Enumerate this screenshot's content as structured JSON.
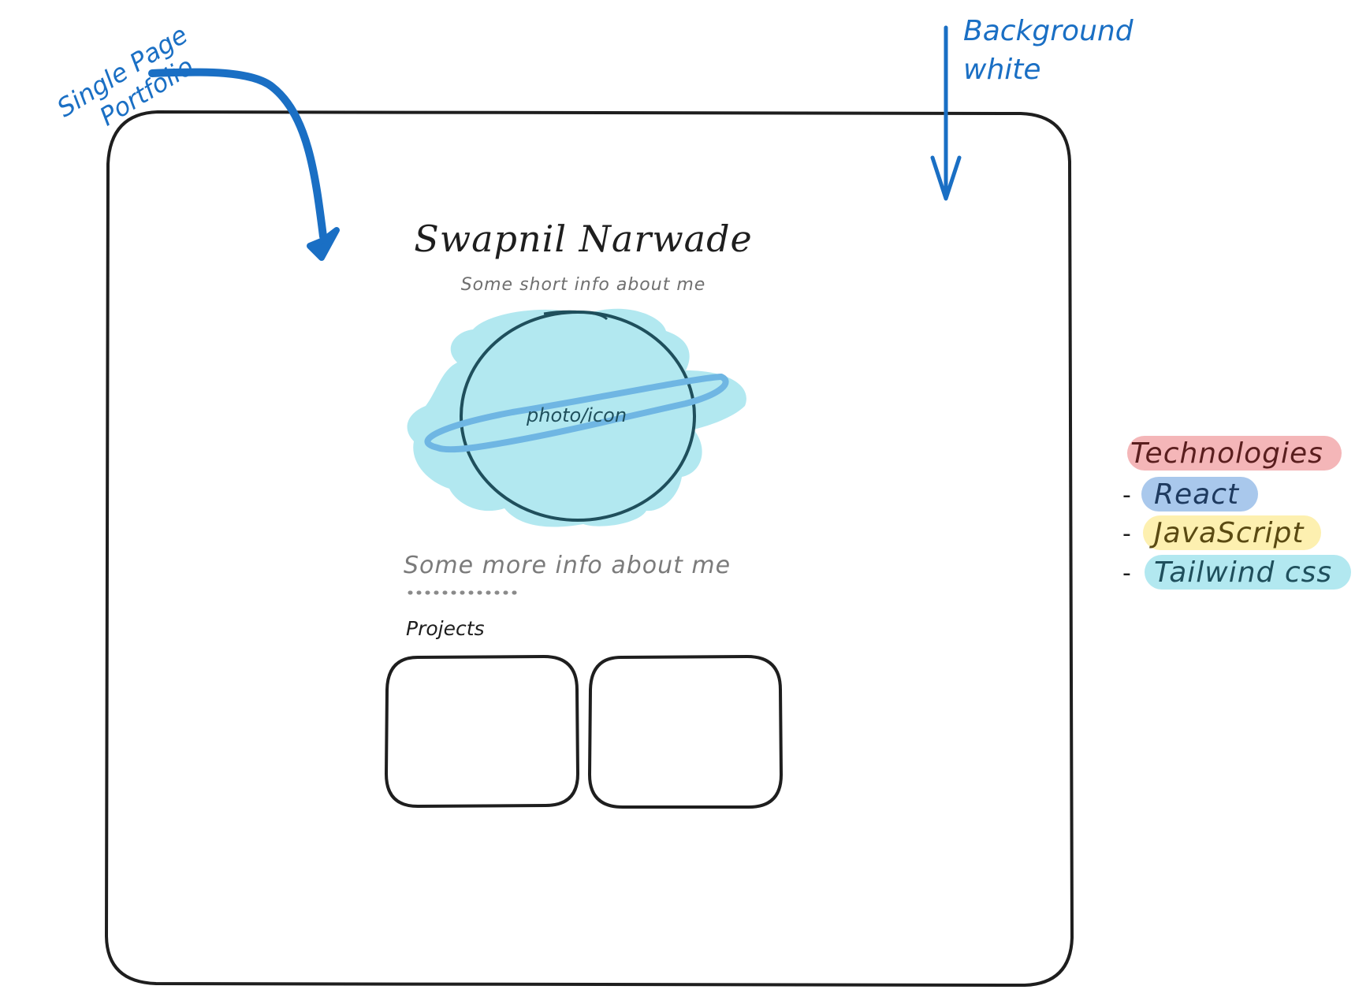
{
  "annotations": {
    "single_page": "Single Page",
    "portfolio": "Portfolio",
    "background": "Background",
    "white": "white"
  },
  "hero": {
    "name": "Swapnil Narwade",
    "short_info": "Some short info about me",
    "photo_label": "photo/icon",
    "more_info": "Some more info about me",
    "projects_label": "Projects"
  },
  "technologies": {
    "title": "Technologies",
    "dash": "-",
    "items": [
      {
        "label": "React",
        "color": "#a9c8ec",
        "text_color": "#1e3a5f"
      },
      {
        "label": "JavaScript",
        "color": "#fdf0b0",
        "text_color": "#5a4a12"
      },
      {
        "label": "Tailwind css",
        "color": "#b2e8f0",
        "text_color": "#1f4f5c"
      }
    ],
    "title_color": "#f4b6b8",
    "title_text_color": "#5a1e1e"
  },
  "colors": {
    "accent_blue": "#1a6fc4",
    "frame": "#1e1e1e",
    "planet_fill": "#b2e8f0",
    "planet_stroke": "#1f4f5c",
    "ring": "#6fb6e3"
  }
}
